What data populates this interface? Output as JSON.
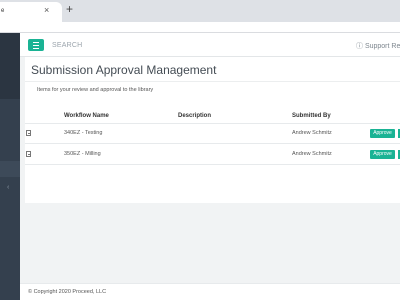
{
  "browser": {
    "tab_title": "e",
    "close_glyph": "×",
    "new_tab_glyph": "+"
  },
  "header": {
    "search_label": "SEARCH",
    "support_label": "ⓘ  Support Res"
  },
  "page": {
    "title": "Submission Approval Management",
    "subtitle": "Items for your review and approval to the library"
  },
  "table": {
    "columns": [
      "Workflow Name",
      "Description",
      "Submitted By"
    ],
    "rows": [
      {
        "workflow": "340EZ - Testing",
        "description": "",
        "submitted_by": "Andrew Schmitz",
        "action": "Approve"
      },
      {
        "workflow": "350EZ - Milling",
        "description": "",
        "submitted_by": "Andrew Schmitz",
        "action": "Approve"
      }
    ]
  },
  "footer": {
    "copyright": "© Copyright 2020 Proceed, LLC"
  },
  "colors": {
    "accent": "#1ab394",
    "sidebar": "#34404e"
  }
}
